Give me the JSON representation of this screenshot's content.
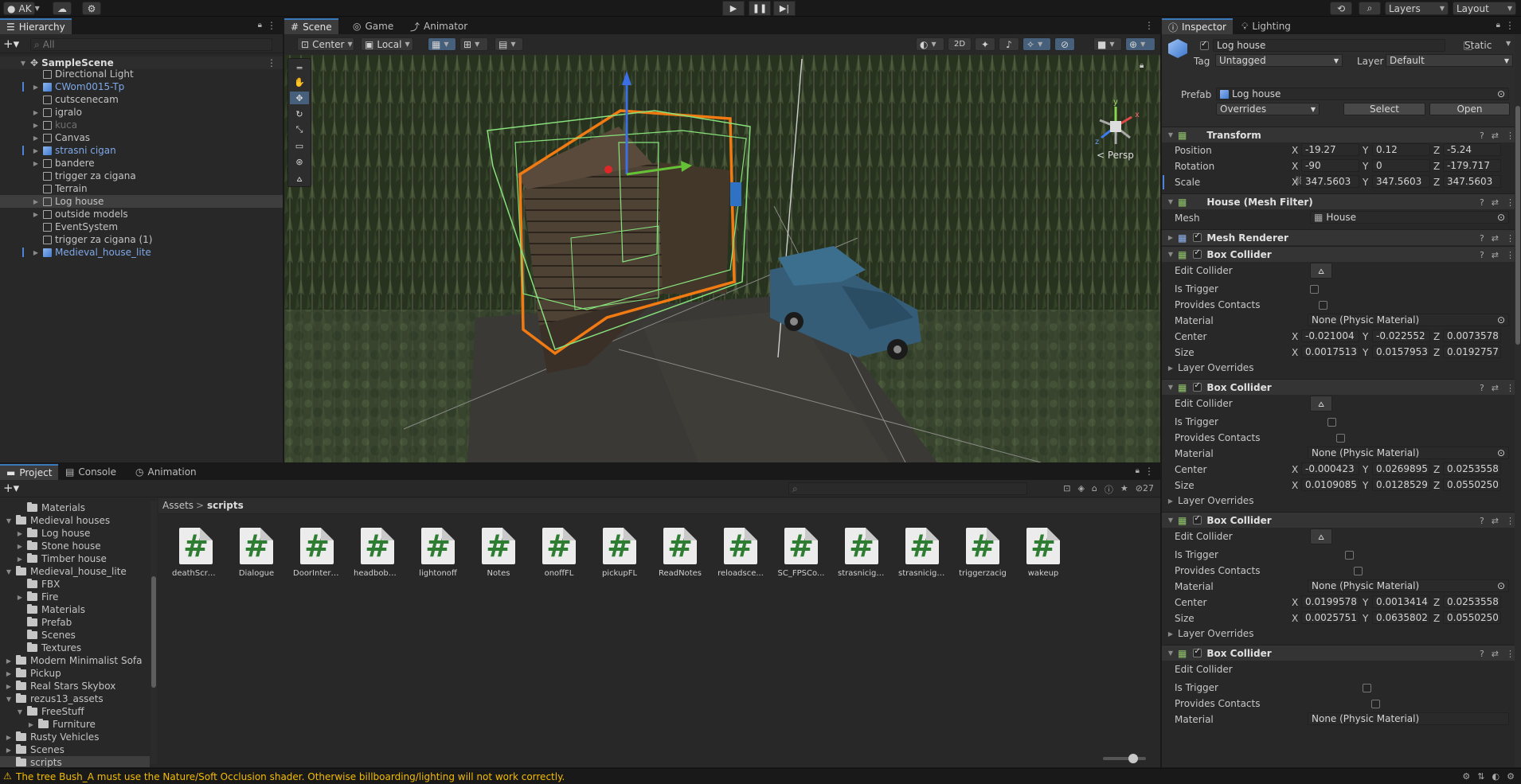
{
  "toolbar": {
    "account": "AK",
    "layers_label": "Layers",
    "layout_label": "Layout"
  },
  "hierarchy": {
    "tab_label": "Hierarchy",
    "search_placeholder": "All",
    "scene_name": "SampleScene",
    "items": [
      {
        "label": "Directional Light",
        "type": "go",
        "fold": false
      },
      {
        "label": "CWom0015-Tp",
        "type": "prefab",
        "fold": true
      },
      {
        "label": "cutscenecam",
        "type": "go",
        "fold": false
      },
      {
        "label": "igralo",
        "type": "go",
        "fold": true
      },
      {
        "label": "kuca",
        "type": "inactive",
        "fold": true
      },
      {
        "label": "Canvas",
        "type": "go",
        "fold": true
      },
      {
        "label": "strasni cigan",
        "type": "prefab",
        "fold": true
      },
      {
        "label": "bandere",
        "type": "go",
        "fold": true
      },
      {
        "label": "trigger za cigana",
        "type": "go",
        "fold": false
      },
      {
        "label": "Terrain",
        "type": "go",
        "fold": false
      },
      {
        "label": "Log house",
        "type": "go",
        "fold": true
      },
      {
        "label": "outside models",
        "type": "go",
        "fold": true
      },
      {
        "label": "EventSystem",
        "type": "go",
        "fold": false
      },
      {
        "label": "trigger za cigana (1)",
        "type": "go",
        "fold": false
      },
      {
        "label": "Medieval_house_lite",
        "type": "prefab",
        "fold": true
      }
    ]
  },
  "scene_tabs": [
    "Scene",
    "Game",
    "Animator"
  ],
  "scene_toolbar": {
    "pivot": "Center",
    "space": "Local",
    "mode_2d": "2D"
  },
  "scene_view": {
    "persp_label": "< Persp"
  },
  "bottom_tabs": [
    "Project",
    "Console",
    "Animation"
  ],
  "project": {
    "tree": [
      {
        "label": "Materials",
        "indent": 1,
        "fold": false
      },
      {
        "label": "Medieval houses",
        "indent": 0,
        "fold": "open"
      },
      {
        "label": "Log house",
        "indent": 1,
        "fold": "closed"
      },
      {
        "label": "Stone house",
        "indent": 1,
        "fold": "closed"
      },
      {
        "label": "Timber house",
        "indent": 1,
        "fold": "closed"
      },
      {
        "label": "Medieval_house_lite",
        "indent": 0,
        "fold": "open"
      },
      {
        "label": "FBX",
        "indent": 1,
        "fold": false
      },
      {
        "label": "Fire",
        "indent": 1,
        "fold": "closed"
      },
      {
        "label": "Materials",
        "indent": 1,
        "fold": false
      },
      {
        "label": "Prefab",
        "indent": 1,
        "fold": false
      },
      {
        "label": "Scenes",
        "indent": 1,
        "fold": false
      },
      {
        "label": "Textures",
        "indent": 1,
        "fold": false
      },
      {
        "label": "Modern Minimalist Sofa",
        "indent": 0,
        "fold": "closed"
      },
      {
        "label": "Pickup",
        "indent": 0,
        "fold": "closed"
      },
      {
        "label": "Real Stars Skybox",
        "indent": 0,
        "fold": "closed"
      },
      {
        "label": "rezus13_assets",
        "indent": 0,
        "fold": "open"
      },
      {
        "label": "FreeStuff",
        "indent": 1,
        "fold": "open"
      },
      {
        "label": "Furniture",
        "indent": 2,
        "fold": "closed"
      },
      {
        "label": "Rusty Vehicles",
        "indent": 0,
        "fold": "closed"
      },
      {
        "label": "Scenes",
        "indent": 0,
        "fold": "closed"
      },
      {
        "label": "scripts",
        "indent": 0,
        "fold": false
      }
    ],
    "breadcrumb_root": "Assets",
    "breadcrumb_sep": ">",
    "breadcrumb_current": "scripts",
    "hidden_count": "27",
    "scripts": [
      "deathScre...",
      "Dialogue",
      "DoorIntera...",
      "headbobbi...",
      "lightonoff",
      "Notes",
      "onoffFL",
      "pickupFL",
      "ReadNotes",
      "reloadsce...",
      "SC_FPSCo...",
      "strasnicigan",
      "strasnicigj...",
      "triggerzacig",
      "wakeup"
    ]
  },
  "inspector": {
    "tabs": [
      "Inspector",
      "Lighting"
    ],
    "object_name": "Log house",
    "static_label": "Static",
    "tag_label": "Tag",
    "tag_value": "Untagged",
    "layer_label": "Layer",
    "layer_value": "Default",
    "prefab_label": "Prefab",
    "prefab_value": "Log house",
    "overrides_label": "Overrides",
    "select_label": "Select",
    "open_label": "Open",
    "transform": {
      "title": "Transform",
      "position_label": "Position",
      "rotation_label": "Rotation",
      "scale_label": "Scale",
      "position": [
        "-19.27",
        "0.12",
        "-5.24"
      ],
      "rotation": [
        "-90",
        "0",
        "-179.717"
      ],
      "scale": [
        "347.5603",
        "347.5603",
        "347.5603"
      ]
    },
    "mesh_filter": {
      "title": "House (Mesh Filter)",
      "mesh_label": "Mesh",
      "mesh_value": "House"
    },
    "mesh_renderer_title": "Mesh Renderer",
    "collider_labels": {
      "title": "Box Collider",
      "edit": "Edit Collider",
      "trigger": "Is Trigger",
      "contacts": "Provides Contacts",
      "material": "Material",
      "center": "Center",
      "size": "Size",
      "overrides": "Layer Overrides",
      "material_value": "None (Physic Material)"
    },
    "colliders": [
      {
        "center": [
          "-0.021004",
          "-0.022552",
          "0.0073578"
        ],
        "size": [
          "0.0017513",
          "0.0157953",
          "0.0192757"
        ]
      },
      {
        "center": [
          "-0.000423",
          "0.0269895",
          "0.0253558"
        ],
        "size": [
          "0.0109085",
          "0.0128529",
          "0.0550250"
        ]
      },
      {
        "center": [
          "0.0199578",
          "0.0013414",
          "0.0253558"
        ],
        "size": [
          "0.0025751",
          "0.0635802",
          "0.0550250"
        ]
      }
    ]
  },
  "axes": [
    "X",
    "Y",
    "Z"
  ],
  "status": {
    "message": "The tree Bush_A must use the Nature/Soft Occlusion shader. Otherwise billboarding/lighting will not work correctly.",
    "warning_color": "#f4bc02"
  }
}
